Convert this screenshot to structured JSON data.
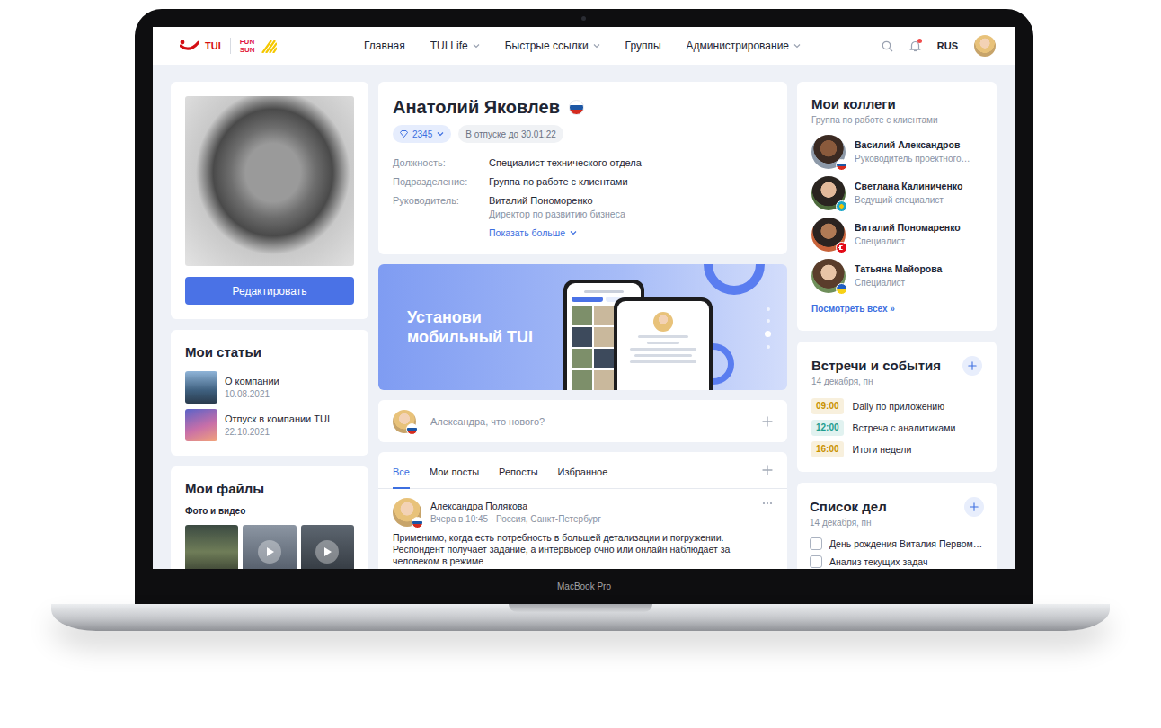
{
  "device": {
    "label": "MacBook Pro"
  },
  "header": {
    "logo": {
      "brand": "TUI",
      "partner_top": "FUN",
      "partner_bottom": "SUN"
    },
    "nav": [
      {
        "label": "Главная",
        "dropdown": false,
        "selected": false
      },
      {
        "label": "TUI Life",
        "dropdown": true,
        "selected": false
      },
      {
        "label": "Быстрые ссылки",
        "dropdown": true,
        "selected": false
      },
      {
        "label": "Группы",
        "dropdown": false,
        "selected": false
      },
      {
        "label": "Администрирование",
        "dropdown": true,
        "selected": false
      }
    ],
    "notifications": {
      "unread": true
    },
    "language": "RUS"
  },
  "profile": {
    "edit_button": "Редактировать",
    "name": "Анатолий Яковлев",
    "flag": "ru",
    "points": "2345",
    "status": "В отпуске до 30.01.22",
    "fields": [
      {
        "label": "Должность:",
        "value": "Специалист технического отдела"
      },
      {
        "label": "Подразделение:",
        "value": "Группа по работе с клиентами"
      },
      {
        "label": "Руководитель:",
        "value": "Виталий Пономоренко",
        "note": "Директор по развитию бизнеса"
      }
    ],
    "show_more": "Показать больше"
  },
  "articles": {
    "title": "Мои статьи",
    "items": [
      {
        "title": "О компании",
        "date": "10.08.2021"
      },
      {
        "title": "Отпуск в компании TUI",
        "date": "22.10.2021"
      }
    ]
  },
  "files": {
    "title": "Мои файлы",
    "section": "Фото и видео",
    "items": [
      {
        "kind": "photo"
      },
      {
        "kind": "video"
      },
      {
        "kind": "video"
      }
    ]
  },
  "banner": {
    "lines": [
      "Установи",
      "мобильный TUI"
    ],
    "slides": [
      {
        "selected": false
      },
      {
        "selected": false
      },
      {
        "selected": true
      },
      {
        "selected": false
      }
    ]
  },
  "composer": {
    "placeholder": "Александра, что нового?",
    "flag": "ru"
  },
  "feed": {
    "tabs": [
      {
        "label": "Все",
        "selected": true
      },
      {
        "label": "Мои посты",
        "selected": false
      },
      {
        "label": "Репосты",
        "selected": false
      },
      {
        "label": "Избранное",
        "selected": false
      }
    ],
    "posts": [
      {
        "author": "Александра Полякова",
        "meta": "Вчера в 10:45 · Россия, Санкт-Петербург",
        "flag": "ru",
        "text": "Применимо, когда есть потребность в большей детализации и погружении. Респондент получает задание, а интервьюер очно или онлайн наблюдает за человеком в режиме"
      }
    ]
  },
  "colleagues": {
    "title": "Мои коллеги",
    "subtitle": "Группа по работе с клиентами",
    "people": [
      {
        "name": "Василий Александров",
        "role": "Руководитель проектного…",
        "flag": "ru"
      },
      {
        "name": "Светлана Калиниченко",
        "role": "Ведущий специалист",
        "flag": "kz"
      },
      {
        "name": "Виталий Пономаренко",
        "role": "Специалист",
        "flag": "tr"
      },
      {
        "name": "Татьяна Майорова",
        "role": "Специалист",
        "flag": "ua"
      }
    ],
    "link": "Посмотреть всех »"
  },
  "events": {
    "title": "Встречи и события",
    "date": "14 декабря, пн",
    "items": [
      {
        "time": "09:00",
        "label": "Daily по приложению",
        "color": "#c99200"
      },
      {
        "time": "12:00",
        "label": "Встреча с аналитиками",
        "color": "#1d9d8f"
      },
      {
        "time": "16:00",
        "label": "Итоги недели",
        "color": "#c99200"
      }
    ]
  },
  "todo": {
    "title": "Список дел",
    "date": "14 декабря, пн",
    "items": [
      {
        "label": "День рождения Виталия Первом…",
        "checked": false
      },
      {
        "label": "Анализ текущих задач",
        "checked": false
      }
    ]
  }
}
